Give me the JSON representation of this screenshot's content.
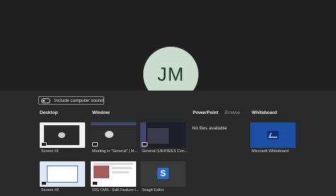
{
  "stage": {
    "avatar_initials": "JM",
    "avatar_color": "#c9dccd"
  },
  "tray": {
    "include_sound_label": "Include computer sound",
    "sections": {
      "desktop": "Desktop",
      "window": "Window",
      "powerpoint": "PowerPoint",
      "browse": "Browse",
      "whiteboard": "Whiteboard"
    },
    "powerpoint_empty": "No files available",
    "desktop_items": [
      {
        "caption": "Screen #1",
        "icon": "monitor-icon"
      },
      {
        "caption": "Screen #2",
        "icon": "monitor-icon"
      }
    ],
    "window_items": [
      {
        "caption": "Meeting in \"General\" | M...",
        "icon": "teams-icon"
      },
      {
        "caption": "General (UK/FR/ES Cont...",
        "icon": "teams-icon"
      },
      {
        "caption": "IDG CMS - Edit Feature l...",
        "icon": "browser-icon"
      },
      {
        "caption": "Snagit Editor",
        "icon": "snagit-icon"
      }
    ],
    "whiteboard_items": [
      {
        "caption": "Microsoft Whiteboard",
        "icon": "whiteboard-icon"
      }
    ]
  }
}
